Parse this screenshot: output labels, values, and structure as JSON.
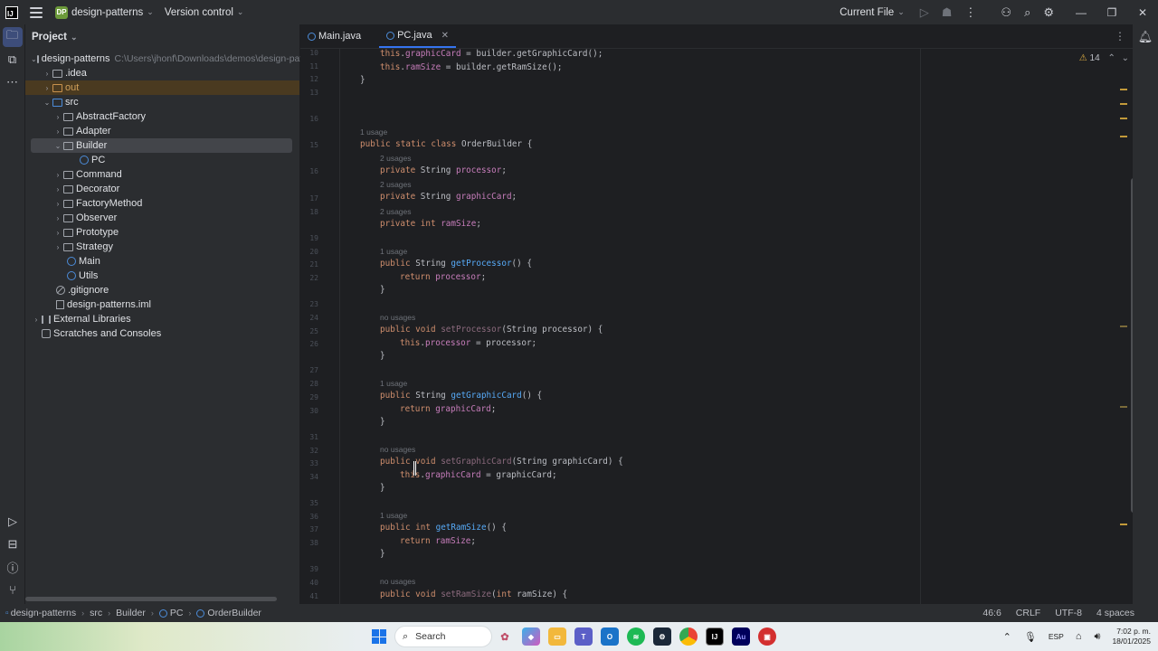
{
  "titlebar": {
    "project_badge": "DP",
    "project_name": "design-patterns",
    "vcs_label": "Version control",
    "run_config": "Current File"
  },
  "project_panel": {
    "title": "Project",
    "root_name": "design-patterns",
    "root_path": "C:\\Users\\jhonf\\Downloads\\demos\\design-patte",
    "items": [
      {
        "label": ".idea"
      },
      {
        "label": "out"
      },
      {
        "label": "src"
      },
      {
        "label": "AbstractFactory"
      },
      {
        "label": "Adapter"
      },
      {
        "label": "Builder"
      },
      {
        "label": "PC"
      },
      {
        "label": "Command"
      },
      {
        "label": "Decorator"
      },
      {
        "label": "FactoryMethod"
      },
      {
        "label": "Observer"
      },
      {
        "label": "Prototype"
      },
      {
        "label": "Strategy"
      },
      {
        "label": "Main"
      },
      {
        "label": "Utils"
      },
      {
        "label": ".gitignore"
      },
      {
        "label": "design-patterns.iml"
      },
      {
        "label": "External Libraries"
      },
      {
        "label": "Scratches and Consoles"
      }
    ]
  },
  "editor": {
    "tabs": [
      {
        "label": "Main.java"
      },
      {
        "label": "PC.java"
      }
    ],
    "warnings": "14",
    "line_numbers": [
      "10",
      "11",
      "12",
      "13",
      "16",
      "15",
      "16",
      "17",
      "18",
      "19",
      "20",
      "21",
      "22",
      "23",
      "24",
      "25",
      "26",
      "27",
      "28",
      "29",
      "30",
      "31",
      "32",
      "33",
      "34",
      "35",
      "36",
      "37",
      "38",
      "39",
      "40",
      "41"
    ],
    "hints": {
      "h1": "1 usage",
      "h2": "2 usages",
      "h3": "2 usages",
      "h4": "2 usages",
      "h5": "1 usage",
      "h6": "no usages",
      "h7": "1 usage",
      "h8": "no usages",
      "h9": "1 usage",
      "h10": "no usages"
    }
  },
  "statusbar": {
    "crumbs": [
      "design-patterns",
      "src",
      "Builder",
      "PC",
      "OrderBuilder"
    ],
    "position": "46:6",
    "line_sep": "CRLF",
    "encoding": "UTF-8",
    "indent": "4 spaces"
  },
  "taskbar": {
    "search": "Search",
    "lang": "ESP",
    "time": "7:02 p. m.",
    "date": "18/01/2025"
  }
}
